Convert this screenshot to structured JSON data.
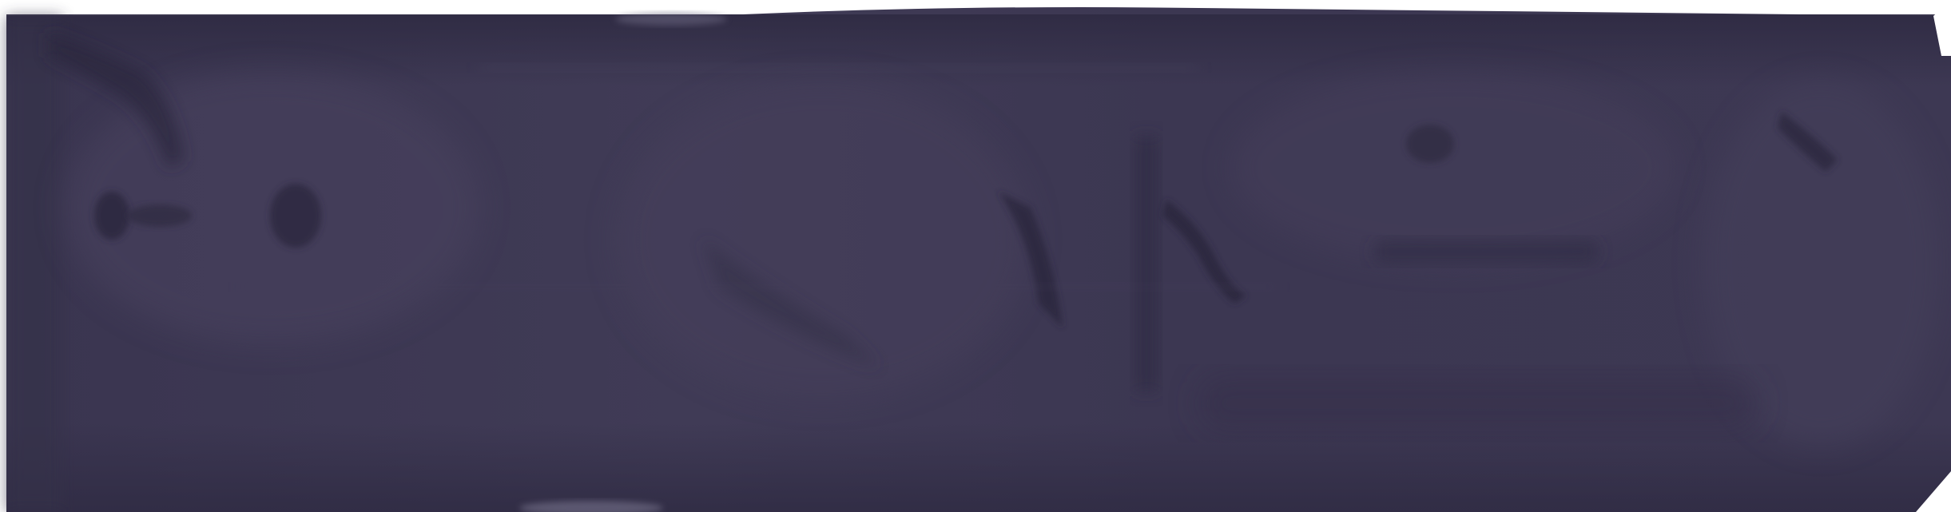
{
  "image": {
    "subject": "abstract-dark-panel",
    "colors": {
      "base": "#3b3650",
      "dark": "#2f2b43",
      "light": "#4a4560",
      "edge": "#ffffff"
    }
  }
}
